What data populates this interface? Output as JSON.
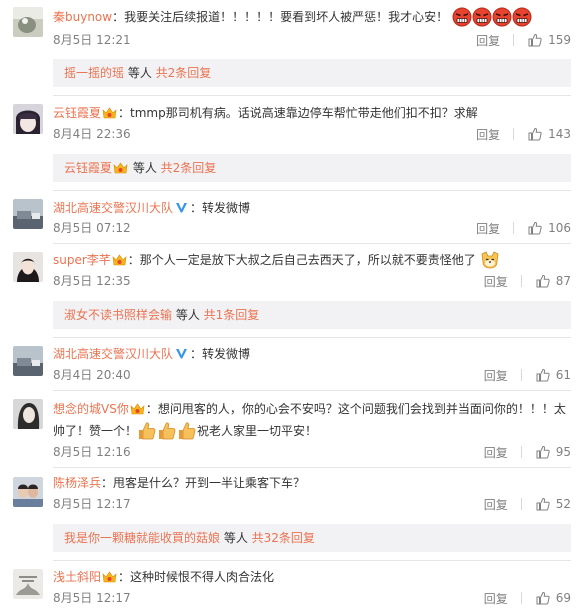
{
  "comments": [
    {
      "user": "秦buynow",
      "text": "：我要关注后续报道！！！！！要看到坏人被严惩！我才心安！",
      "emoji": [
        "angry-face",
        "angry-face",
        "angry-face",
        "angry-face"
      ],
      "time": "8月5日 12:21",
      "reply": "回复",
      "likes": "159",
      "subreply": {
        "user": "摇一摇的瑶",
        "middle": " 等人 ",
        "count": "共2条回复"
      }
    },
    {
      "user": "云钰霞夏",
      "text": "：tmmp那司机有病。话说高速靠边停车帮忙带走他们扣不扣？求解",
      "time": "8月4日 22:36",
      "reply": "回复",
      "likes": "143",
      "subreply": {
        "user": "云钰霞夏",
        "middle": " 等人 ",
        "count": "共2条回复"
      }
    },
    {
      "user": "湖北高速交警汉川大队",
      "text": "：转发微博",
      "time": "8月5日 07:12",
      "reply": "回复",
      "likes": "106"
    },
    {
      "user": "super李芊",
      "text": "：那个人一定是放下大叔之后自己去西天了，所以就不要责怪他了",
      "time": "8月5日 12:35",
      "reply": "回复",
      "likes": "87",
      "subreply": {
        "user": "淑女不读书照样会输",
        "middle": " 等人 ",
        "count": "共1条回复"
      }
    },
    {
      "user": "湖北高速交警汉川大队",
      "text": "：转发微博",
      "time": "8月4日 20:40",
      "reply": "回复",
      "likes": "61"
    },
    {
      "user": "想念的城VS你",
      "text_a": "：想问甩客的人，你的心会不安吗？这个问题我们会找到并当面问你的！！！太帅了！赞一个！",
      "text_b": "祝老人家里一切平安！",
      "time": "8月5日 12:16",
      "reply": "回复",
      "likes": "95"
    },
    {
      "user": "陈杨泽兵",
      "text": "：甩客是什么？开到一半让乘客下车？",
      "time": "8月5日 12:17",
      "reply": "回复",
      "likes": "52",
      "subreply": {
        "user": "我是你一颗糖就能收買的菇娘",
        "middle": " 等人 ",
        "count": "共32条回复"
      }
    },
    {
      "user": "浅土斜阳",
      "text": "：这种时候恨不得人肉合法化",
      "time": "8月5日 12:17",
      "reply": "回复",
      "likes": "69"
    }
  ],
  "colors": {
    "username": "#eb7350",
    "time": "#808080",
    "subbox": "#f2f2f5",
    "verified": "#3396e8"
  }
}
